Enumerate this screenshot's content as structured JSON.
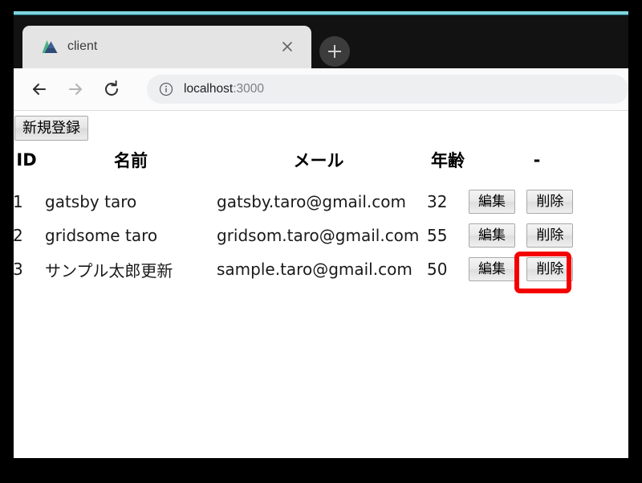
{
  "browser": {
    "tab": {
      "title": "client",
      "favicon_icon": "gatsby-mountain-icon",
      "close_icon": "close-icon"
    },
    "new_tab_icon": "plus-icon",
    "toolbar": {
      "back_icon": "back-arrow-icon",
      "forward_icon": "forward-arrow-icon",
      "reload_icon": "reload-icon",
      "site_info_icon": "info-circle-icon",
      "url_host": "localhost",
      "url_port": ":3000"
    }
  },
  "page": {
    "register_button": "新規登録",
    "table": {
      "headers": [
        "ID",
        "名前",
        "メール",
        "年齢",
        "-"
      ],
      "rows": [
        {
          "id": "1",
          "name": "gatsby taro",
          "email": "gatsby.taro@gmail.com",
          "age": "32",
          "edit_label": "編集",
          "delete_label": "削除"
        },
        {
          "id": "2",
          "name": "gridsome taro",
          "email": "gridsom.taro@gmail.com",
          "age": "55",
          "edit_label": "編集",
          "delete_label": "削除"
        },
        {
          "id": "3",
          "name": "サンプル太郎更新",
          "email": "sample.taro@gmail.com",
          "age": "50",
          "edit_label": "編集",
          "delete_label": "削除"
        }
      ]
    }
  },
  "annotation": {
    "highlight_color": "#f50000",
    "highlight_target": "delete-button-row-3"
  },
  "theme": {
    "accent_strip": "#7fd4dd",
    "tab_bg": "#e4e4e4",
    "tabstrip_bg": "#121212",
    "omnibox_bg": "#eeeff1"
  }
}
